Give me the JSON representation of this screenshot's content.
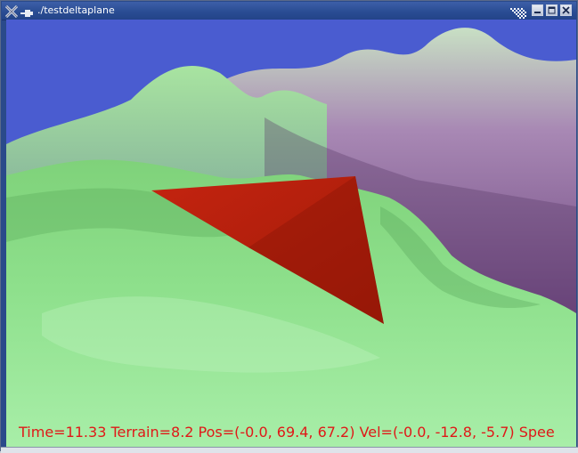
{
  "window": {
    "title": "./testdeltaplane",
    "colors": {
      "titlebar": "#2a4d94",
      "title_text": "#ffffff"
    },
    "icons": [
      "x-app-icon",
      "pin-icon",
      "checker-pattern-icon",
      "minimize-icon",
      "maximize-icon",
      "close-icon"
    ]
  },
  "scene": {
    "colors": {
      "sky": "#4a5cd0",
      "terrain_near": "#88e088",
      "terrain_far": "#8a5a96",
      "plane": "#b81e0c"
    }
  },
  "hud": {
    "text": "Time=11.33 Terrain=8.2 Pos=(-0.0, 69.4, 67.2) Vel=(-0.0, -12.8, -5.7)  Spee",
    "color": "#e01818"
  }
}
